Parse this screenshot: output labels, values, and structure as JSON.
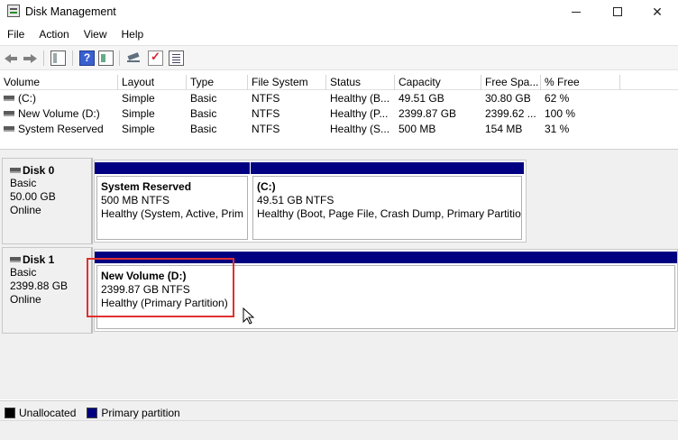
{
  "window": {
    "title": "Disk Management",
    "icon": "disk-management-icon",
    "controls": {
      "minimize": "minimize-icon",
      "maximize": "maximize-icon",
      "close": "✕"
    }
  },
  "menu": [
    "File",
    "Action",
    "View",
    "Help"
  ],
  "toolbar": {
    "icons": [
      "back-arrow-icon",
      "forward-arrow-icon",
      "console-tree-icon",
      "help-icon",
      "properties-icon",
      "connect-disk-icon",
      "check-icon",
      "list-icon"
    ],
    "help_glyph": "?"
  },
  "volume_list": {
    "columns": [
      "Volume",
      "Layout",
      "Type",
      "File System",
      "Status",
      "Capacity",
      "Free Spa...",
      "% Free"
    ],
    "rows": [
      {
        "volume": "(C:)",
        "layout": "Simple",
        "type": "Basic",
        "fs": "NTFS",
        "status": "Healthy (B...",
        "capacity": "49.51 GB",
        "free": "30.80 GB",
        "pct": "62 %"
      },
      {
        "volume": "New Volume (D:)",
        "layout": "Simple",
        "type": "Basic",
        "fs": "NTFS",
        "status": "Healthy (P...",
        "capacity": "2399.87 GB",
        "free": "2399.62 ...",
        "pct": "100 %"
      },
      {
        "volume": "System Reserved",
        "layout": "Simple",
        "type": "Basic",
        "fs": "NTFS",
        "status": "Healthy (S...",
        "capacity": "500 MB",
        "free": "154 MB",
        "pct": "31 %"
      }
    ]
  },
  "disks": [
    {
      "name": "Disk 0",
      "type": "Basic",
      "size": "50.00 GB",
      "state": "Online",
      "partitions": [
        {
          "name": "System Reserved",
          "size": "500 MB NTFS",
          "status": "Healthy (System, Active, Prim"
        },
        {
          "name": "(C:)",
          "size": "49.51 GB NTFS",
          "status": "Healthy (Boot, Page File, Crash Dump, Primary Partition"
        }
      ]
    },
    {
      "name": "Disk 1",
      "type": "Basic",
      "size": "2399.88 GB",
      "state": "Online",
      "partitions": [
        {
          "name": "New Volume  (D:)",
          "size": "2399.87 GB NTFS",
          "status": "Healthy (Primary Partition)"
        }
      ]
    }
  ],
  "legend": [
    {
      "label": "Unallocated",
      "color": "#000000"
    },
    {
      "label": "Primary partition",
      "color": "#000080"
    }
  ],
  "colors": {
    "primary_partition": "#000080",
    "highlight": "#e03030"
  }
}
